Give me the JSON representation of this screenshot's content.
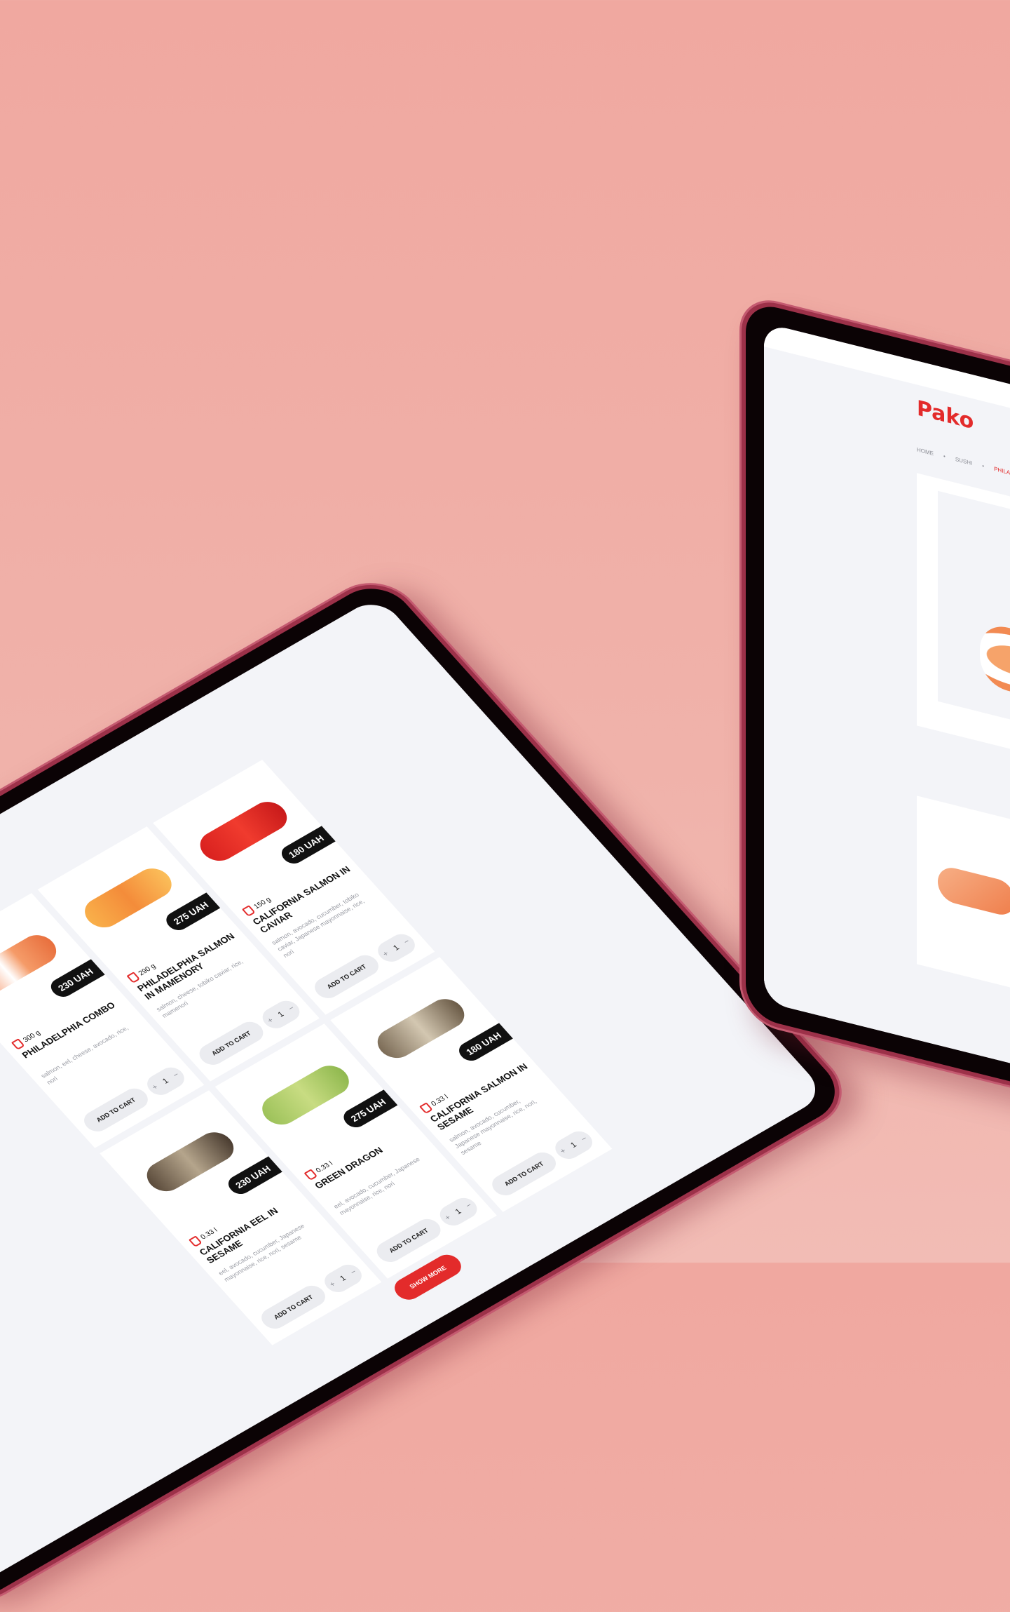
{
  "menu": {
    "items": [
      {
        "price": "230 UAH",
        "meta": "300 g",
        "name": "PHILADELPHIA COMBO",
        "ingredients": "salmon, eel, cheese, avocado, rice, nori",
        "cart": "ADD TO CART",
        "qty": "1",
        "roll": "salmon"
      },
      {
        "price": "275 UAH",
        "meta": "290 g",
        "name": "PHILADELPHIA SALMON IN MAMENORY",
        "ingredients": "salmon, cheese, tobiko caviar, rice, mamenori",
        "cart": "ADD TO CART",
        "qty": "1",
        "roll": "orange"
      },
      {
        "price": "180 UAH",
        "meta": "150 g",
        "name": "CALIFORNIA SALMON IN CAVIAR",
        "ingredients": "salmon, avocado, cucumber, tobiko caviar, Japanese mayonnaise, rice, nori",
        "cart": "ADD TO CART",
        "qty": "1",
        "roll": "red"
      },
      {
        "price": "230 UAH",
        "meta": "0.33 l",
        "name": "CALIFORNIA EEL IN SESAME",
        "ingredients": "eel, avocado, cucumber, Japanese mayonnaise, rice, nori, sesame",
        "cart": "ADD TO CART",
        "qty": "1",
        "roll": "sesame"
      },
      {
        "price": "275 UAH",
        "meta": "0.33 l",
        "name": "GREEN DRAGON",
        "ingredients": "eel, avocado, cucumber, Japanese mayonnaise, rice, nori",
        "cart": "ADD TO CART",
        "qty": "1",
        "roll": "green"
      },
      {
        "price": "180 UAH",
        "meta": "0.33 l",
        "name": "CALIFORNIA SALMON IN SESAME",
        "ingredients": "salmon, avocado, cucumber, Japanese mayonnaise, rice, nori, sesame",
        "cart": "ADD TO CART",
        "qty": "1",
        "roll": "sesame2"
      }
    ],
    "show_more": "SHOW MORE"
  },
  "detail": {
    "logo": "Pako",
    "breadcrumb": [
      "HOME",
      "SUSHI",
      "PHILADE"
    ]
  },
  "colors": {
    "accent": "#e32b2b",
    "background": "#f0a8a0",
    "device": "#9c3149"
  }
}
